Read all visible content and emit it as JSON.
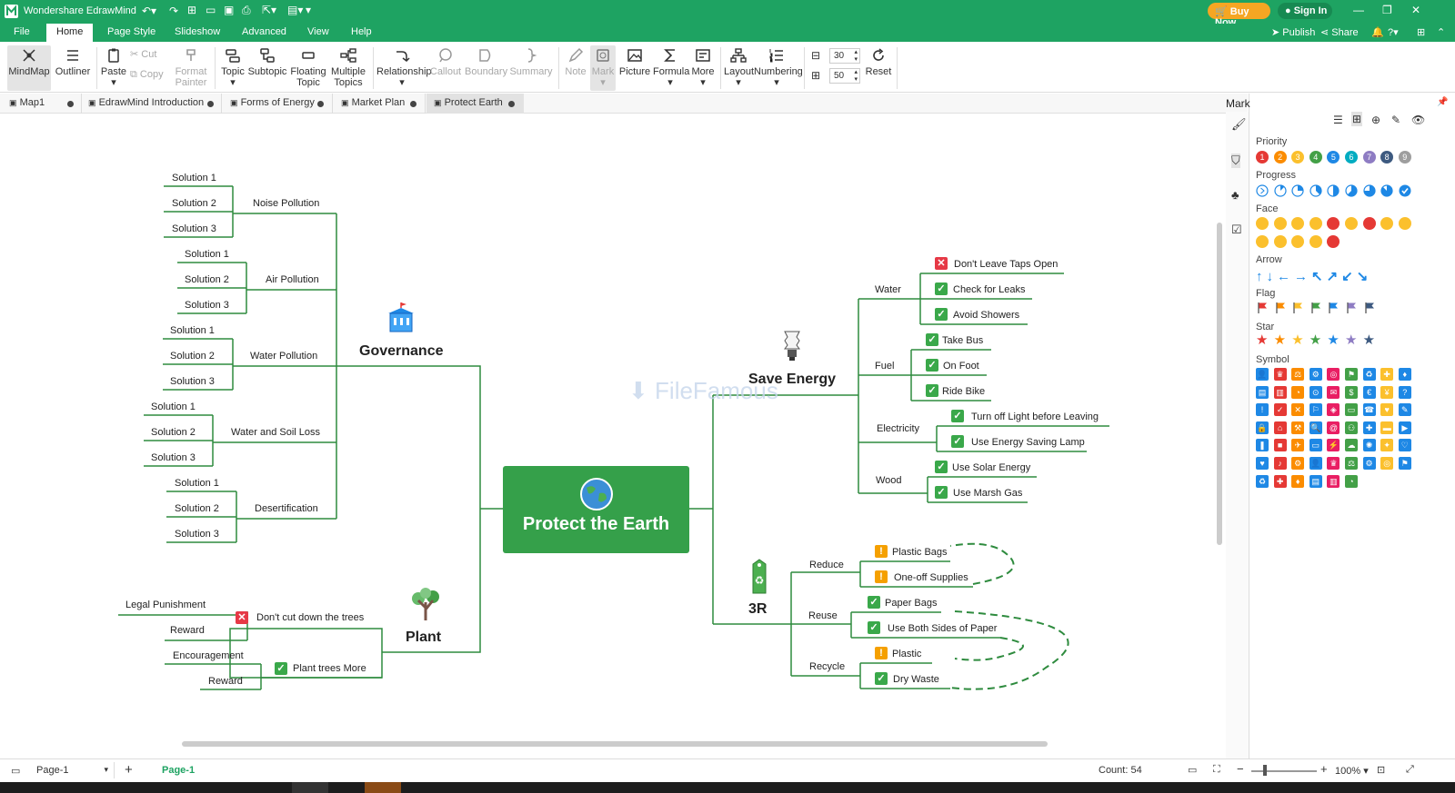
{
  "app": {
    "title": "Wondershare EdrawMind",
    "buy_now": "Buy Now",
    "sign_in": "Sign In",
    "publish": "Publish",
    "share": "Share"
  },
  "menu": [
    "File",
    "Home",
    "Page Style",
    "Slideshow",
    "Advanced",
    "View",
    "Help"
  ],
  "ribbon": {
    "mindmap": "MindMap",
    "outliner": "Outliner",
    "paste": "Paste",
    "cut": "Cut",
    "copy": "Copy",
    "format_painter_1": "Format",
    "format_painter_2": "Painter",
    "topic": "Topic",
    "subtopic": "Subtopic",
    "floating_1": "Floating",
    "floating_2": "Topic",
    "multiple_1": "Multiple",
    "multiple_2": "Topics",
    "relationship": "Relationship",
    "callout": "Callout",
    "boundary": "Boundary",
    "summary": "Summary",
    "note": "Note",
    "mark": "Mark",
    "picture": "Picture",
    "formula": "Formula",
    "more": "More",
    "layout": "Layout",
    "numbering": "Numbering",
    "spacing_h": "30",
    "spacing_v": "50",
    "reset": "Reset"
  },
  "tabs": [
    "Map1",
    "EdrawMind Introduction",
    "Forms of Energy",
    "Market Plan",
    "Protect Earth"
  ],
  "watermark": "FileFamous",
  "mindmap": {
    "central": "Protect the Earth",
    "governance": {
      "title": "Governance",
      "topics": [
        "Noise Pollution",
        "Air Pollution",
        "Water Pollution",
        "Water and Soil Loss",
        "Desertification"
      ],
      "solutions": [
        "Solution 1",
        "Solution 2",
        "Solution 3"
      ]
    },
    "plant": {
      "title": "Plant",
      "t1": "Don't cut down the trees",
      "t1a": "Legal Punishment",
      "t1b": "Reward",
      "t2": "Plant trees More",
      "t2a": "Encouragement",
      "t2b": "Reward"
    },
    "energy": {
      "title": "Save Energy",
      "water": "Water",
      "w1": "Don't Leave Taps Open",
      "w2": "Check for Leaks",
      "w3": "Avoid Showers",
      "fuel": "Fuel",
      "f1": "Take Bus",
      "f2": "On Foot",
      "f3": "Ride Bike",
      "electricity": "Electricity",
      "e1": "Turn off Light before Leaving",
      "e2": "Use Energy Saving Lamp",
      "wood": "Wood",
      "wd1": "Use Solar Energy",
      "wd2": "Use Marsh Gas"
    },
    "r3": {
      "title": "3R",
      "reduce": "Reduce",
      "rd1": "Plastic Bags",
      "rd2": "One-off Supplies",
      "reuse": "Reuse",
      "ru1": "Paper Bags",
      "ru2": "Use Both Sides of Paper",
      "recycle": "Recycle",
      "rc1": "Plastic",
      "rc2": "Dry Waste"
    }
  },
  "panel": {
    "title": "Mark",
    "priority": "Priority",
    "progress": "Progress",
    "face": "Face",
    "arrow": "Arrow",
    "flag": "Flag",
    "star": "Star",
    "symbol": "Symbol",
    "priority_nums": [
      "1",
      "2",
      "3",
      "4",
      "5",
      "6",
      "7",
      "8",
      "9"
    ],
    "priority_colors": [
      "#e53935",
      "#fb8c00",
      "#fbc02d",
      "#43a047",
      "#1e88e5",
      "#00acc1",
      "#8e7cc3",
      "#3d5a80",
      "#9e9e9e"
    ],
    "flag_colors": [
      "#e53935",
      "#fb8c00",
      "#fbc02d",
      "#43a047",
      "#1e88e5",
      "#8e7cc3",
      "#3d5a80"
    ],
    "star_colors": [
      "#e53935",
      "#fb8c00",
      "#fbc02d",
      "#43a047",
      "#1e88e5",
      "#8e7cc3",
      "#3d5a80"
    ]
  },
  "status": {
    "page_tab": "Page-1",
    "page_active": "Page-1",
    "count": "Count: 54",
    "zoom": "100%"
  },
  "colors": {
    "brand": "#1ea362",
    "branch": "#2e8b3e",
    "central": "#35a04a"
  }
}
